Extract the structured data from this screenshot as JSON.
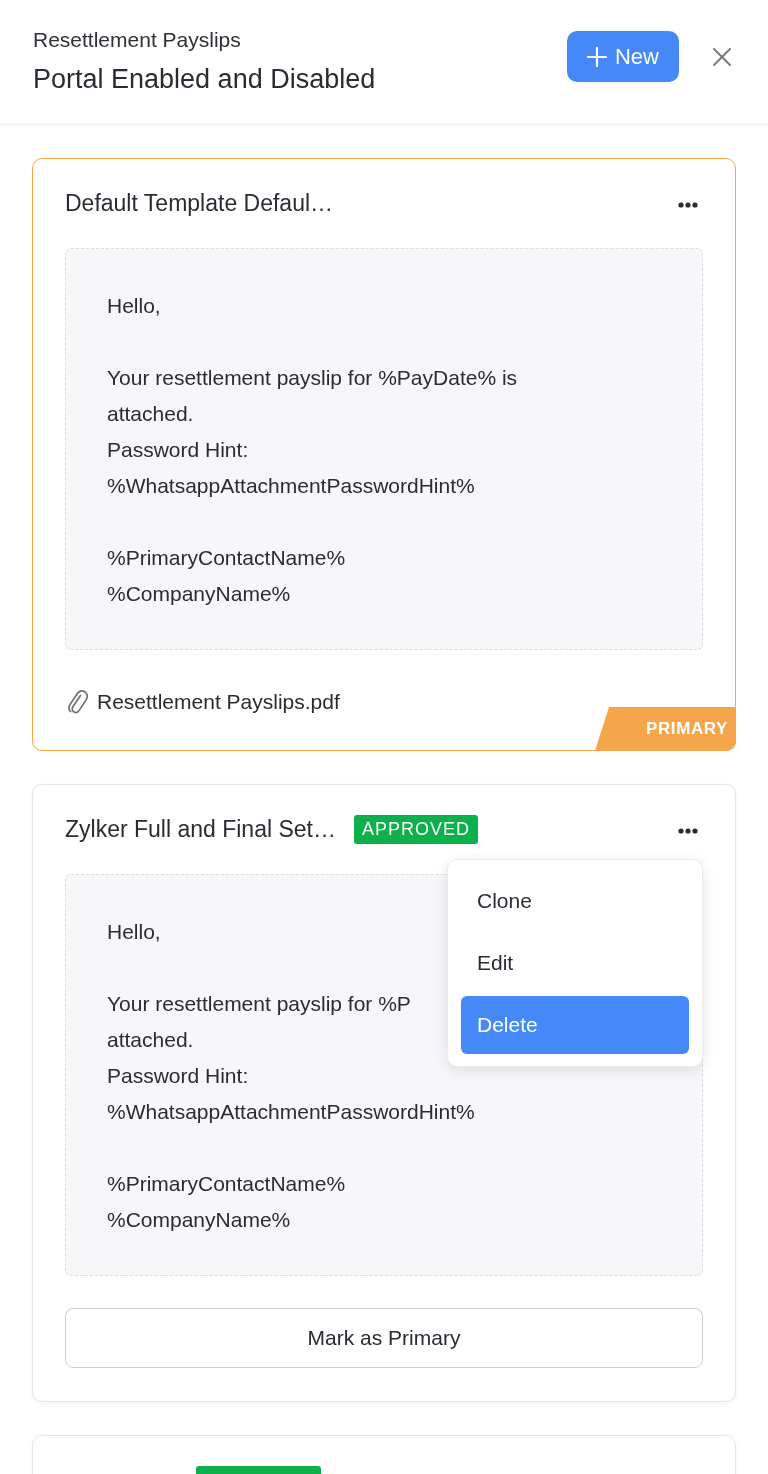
{
  "header": {
    "subtitle": "Resettlement Payslips",
    "title": "Portal Enabled and Disabled",
    "new_button": "New"
  },
  "templates": [
    {
      "title": "Default Template Defaul…",
      "primary": true,
      "approved": false,
      "message": [
        [
          "Hello,"
        ],
        [
          "Your resettlement payslip for %PayDate% is",
          "attached.",
          "Password Hint:",
          "%WhatsappAttachmentPasswordHint%"
        ],
        [
          "%PrimaryContactName%",
          "%CompanyName%"
        ]
      ],
      "attachment": "Resettlement Payslips.pdf",
      "primary_label": "PRIMARY"
    },
    {
      "title": "Zylker Full and Final Set…",
      "primary": false,
      "approved": true,
      "status": "APPROVED",
      "message": [
        [
          "Hello,"
        ],
        [
          "Your resettlement payslip for %P",
          "attached.",
          "Password Hint:",
          "%WhatsappAttachmentPasswordHint%"
        ],
        [
          "%PrimaryContactName%",
          "%CompanyName%"
        ]
      ],
      "menu": [
        {
          "label": "Clone",
          "highlighted": false
        },
        {
          "label": "Edit",
          "highlighted": false
        },
        {
          "label": "Delete",
          "highlighted": true
        }
      ],
      "action_button": "Mark as Primary"
    },
    {
      "primary": false,
      "approved": true
    }
  ]
}
